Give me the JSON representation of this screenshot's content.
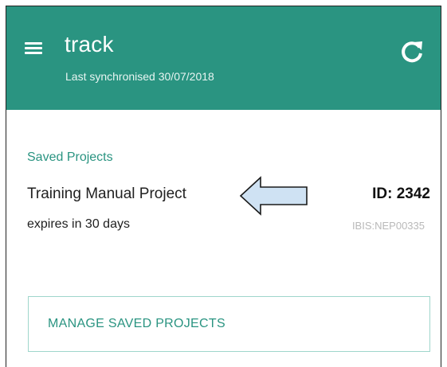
{
  "app_bar": {
    "title": "track",
    "subtitle": "Last synchronised 30/07/2018",
    "menu_icon": "hamburger-menu-icon",
    "refresh_icon": "refresh-icon",
    "color": "#2a9481"
  },
  "saved_projects": {
    "section_label": "Saved Projects",
    "items": [
      {
        "name": "Training Manual Project",
        "id_label": "ID: 2342",
        "expiry": "expires in 30 days",
        "code": "IBIS:NEP00335"
      }
    ],
    "manage_button_label": "MANAGE SAVED PROJECTS"
  },
  "annotation": {
    "arrow_icon": "left-pointing-arrow-icon",
    "arrow_color": "#cfe2f3"
  }
}
